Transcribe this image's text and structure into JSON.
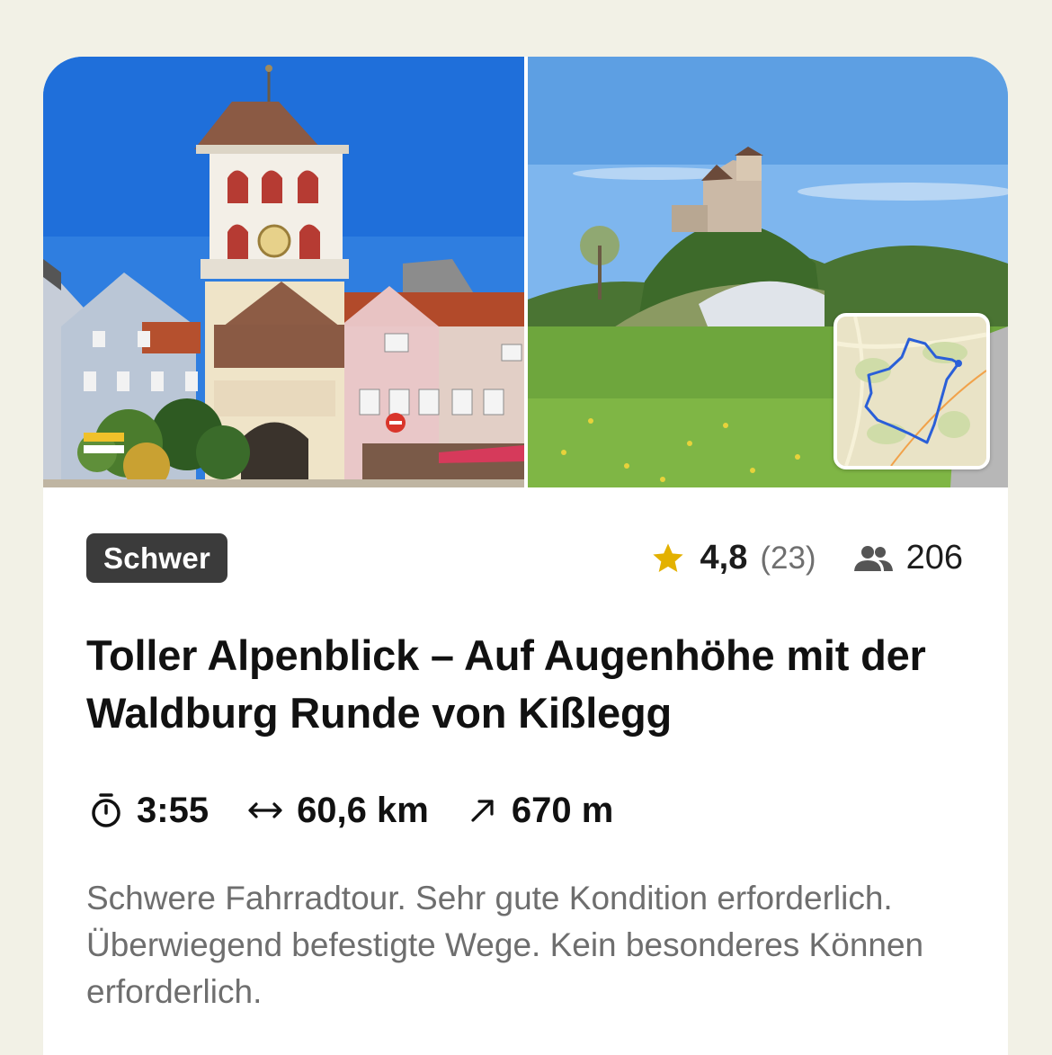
{
  "tour": {
    "difficulty": "Schwer",
    "rating": "4,8",
    "rating_count": "(23)",
    "participants": "206",
    "title": "Toller Alpenblick – Auf Augenhöhe mit der Waldburg Runde von Kißlegg",
    "duration": "3:55",
    "distance": "60,6 km",
    "elevation": "670 m",
    "description": "Schwere Fahrradtour. Sehr gute Kondition erforderlich. Überwiegend befestigte Wege. Kein besonderes Können erforderlich."
  },
  "icons": {
    "rating": "star-icon",
    "participants": "people-icon",
    "duration": "stopwatch-icon",
    "distance": "horizontal-arrows-icon",
    "elevation": "diagonal-arrow-icon"
  },
  "colors": {
    "background": "#f2f1e6",
    "badge": "#3b3b3b",
    "star": "#e3b100",
    "route_line": "#2a5fd8"
  }
}
